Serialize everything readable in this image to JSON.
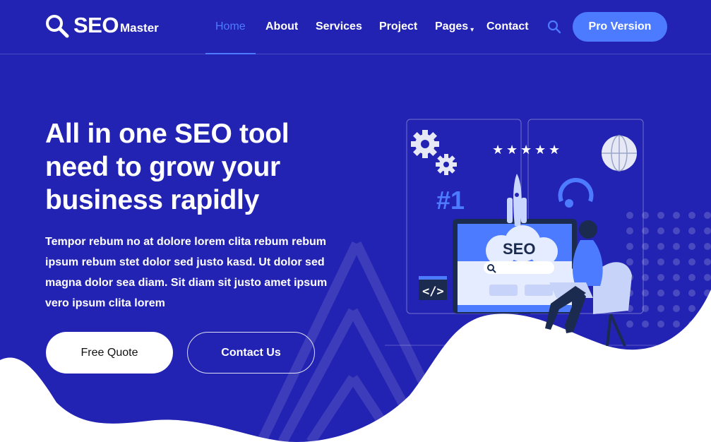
{
  "brand": {
    "main": "SEO",
    "sub": "Master",
    "icon": "search-icon"
  },
  "nav": {
    "items": [
      {
        "label": "Home",
        "active": true
      },
      {
        "label": "About"
      },
      {
        "label": "Services"
      },
      {
        "label": "Project"
      },
      {
        "label": "Pages",
        "caret": "chevron-down-icon"
      },
      {
        "label": "Contact"
      }
    ],
    "search_icon": "search-icon",
    "pro_button": "Pro Version"
  },
  "hero": {
    "title": "All in one SEO tool need to grow your business rapidly",
    "text": "Tempor rebum no at dolore lorem clita rebum rebum ipsum rebum stet dolor sed justo kasd. Ut dolor sed magna dolor sea diam. Sit diam sit justo amet ipsum vero ipsum clita lorem",
    "quote_button": "Free Quote",
    "contact_button": "Contact Us"
  },
  "illustration": {
    "rank_label": "#1",
    "seo_label": "SEO",
    "rating_stars": 5,
    "code_label": "</>"
  },
  "colors": {
    "background": "#2323b3",
    "accent": "#4d7bff",
    "white": "#ffffff"
  }
}
